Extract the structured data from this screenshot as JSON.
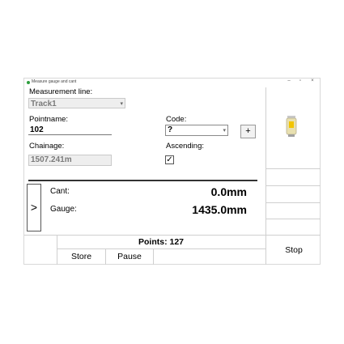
{
  "window": {
    "title": "Measure gauge and cant",
    "buttons": [
      "–",
      "▫",
      "×"
    ]
  },
  "form": {
    "measurement_line": {
      "label": "Measurement line:",
      "value": "Track1"
    },
    "pointname": {
      "label": "Pointname:",
      "value": "102"
    },
    "code": {
      "label": "Code:",
      "value": "?",
      "add_button": "+"
    },
    "chainage": {
      "label": "Chainage:",
      "value": "1507.241m"
    },
    "ascending": {
      "label": "Ascending:",
      "checked": true,
      "check_glyph": "✓"
    }
  },
  "measurements": {
    "next_button": ">",
    "cant": {
      "label": "Cant:",
      "value": "0.0mm"
    },
    "gauge": {
      "label": "Gauge:",
      "value": "1435.0mm"
    }
  },
  "footer": {
    "points": "Points: 127",
    "store": "Store",
    "pause": "Pause",
    "stop": "Stop"
  },
  "icons": {
    "instrument": "total-station-icon"
  },
  "colors": {
    "app_icon": "#2e9e3e",
    "disabled_bg": "#eeeeee",
    "disabled_text": "#7a7a7a"
  }
}
